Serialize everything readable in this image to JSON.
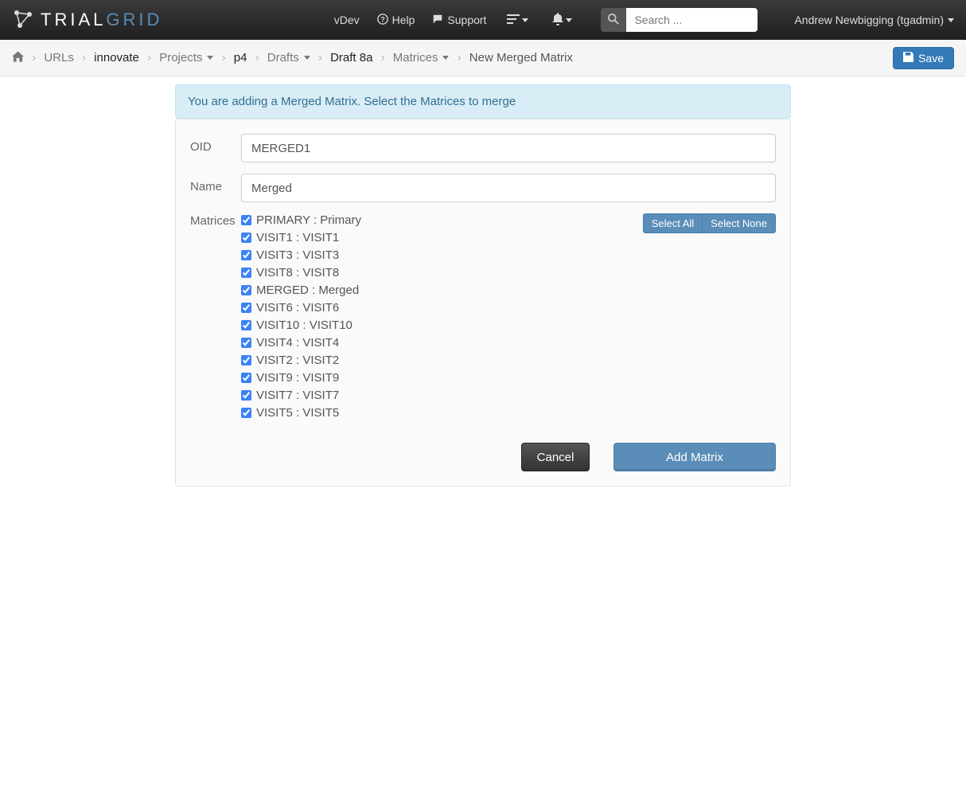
{
  "brand": {
    "part1": "TRIAL",
    "part2": "GRID"
  },
  "nav": {
    "vdev": "vDev",
    "help": "Help",
    "support": "Support"
  },
  "search": {
    "placeholder": "Search ..."
  },
  "user": {
    "display": "Andrew Newbigging (tgadmin)"
  },
  "breadcrumb": {
    "urls": "URLs",
    "innovate": "innovate",
    "projects": "Projects",
    "p4": "p4",
    "drafts": "Drafts",
    "draft8a": "Draft 8a",
    "matrices": "Matrices",
    "current": "New Merged Matrix"
  },
  "save_label": "Save",
  "alert": "You are adding a Merged Matrix. Select the Matrices to merge",
  "form": {
    "oid_label": "OID",
    "oid_value": "MERGED1",
    "name_label": "Name",
    "name_value": "Merged",
    "matrices_label": "Matrices",
    "select_all": "Select All",
    "select_none": "Select None",
    "matrices": [
      {
        "label": "PRIMARY : Primary",
        "checked": true
      },
      {
        "label": "VISIT1 : VISIT1",
        "checked": true
      },
      {
        "label": "VISIT3 : VISIT3",
        "checked": true
      },
      {
        "label": "VISIT8 : VISIT8",
        "checked": true
      },
      {
        "label": "MERGED : Merged",
        "checked": true
      },
      {
        "label": "VISIT6 : VISIT6",
        "checked": true
      },
      {
        "label": "VISIT10 : VISIT10",
        "checked": true
      },
      {
        "label": "VISIT4 : VISIT4",
        "checked": true
      },
      {
        "label": "VISIT2 : VISIT2",
        "checked": true
      },
      {
        "label": "VISIT9 : VISIT9",
        "checked": true
      },
      {
        "label": "VISIT7 : VISIT7",
        "checked": true
      },
      {
        "label": "VISIT5 : VISIT5",
        "checked": true
      }
    ],
    "cancel": "Cancel",
    "add": "Add Matrix"
  }
}
